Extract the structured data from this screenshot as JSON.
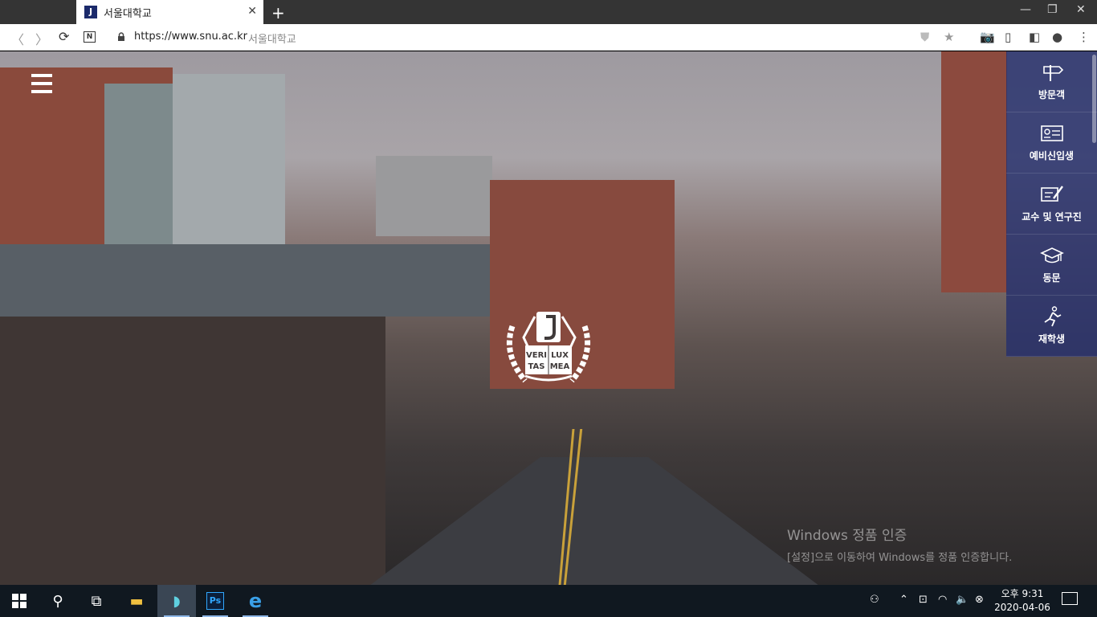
{
  "browser": {
    "tab_title": "서울대학교",
    "tab_favicon": "J",
    "url": "https://www.snu.ac.kr",
    "url_page_title": "서울대학교",
    "new_tab_label": "+"
  },
  "page": {
    "quick_menu": [
      {
        "label": "방문객",
        "icon": "signpost-icon"
      },
      {
        "label": "예비신입생",
        "icon": "id-card-icon"
      },
      {
        "label": "교수 및 연구진",
        "icon": "pen-board-icon"
      },
      {
        "label": "동문",
        "icon": "graduation-cap-icon"
      },
      {
        "label": "재학생",
        "icon": "walking-person-icon"
      }
    ],
    "emblem_text": [
      "VERI",
      "LUX",
      "TAS",
      "MEA"
    ]
  },
  "watermark": {
    "line1": "Windows 정품 인증",
    "line2": "[설정]으로 이동하여 Windows를 정품 인증합니다."
  },
  "taskbar": {
    "time": "오후 9:31",
    "date": "2020-04-06"
  },
  "colors": {
    "quick_menu_bg": "#26306c",
    "tab_bar_bg": "#343434",
    "taskbar_bg": "#101820"
  }
}
